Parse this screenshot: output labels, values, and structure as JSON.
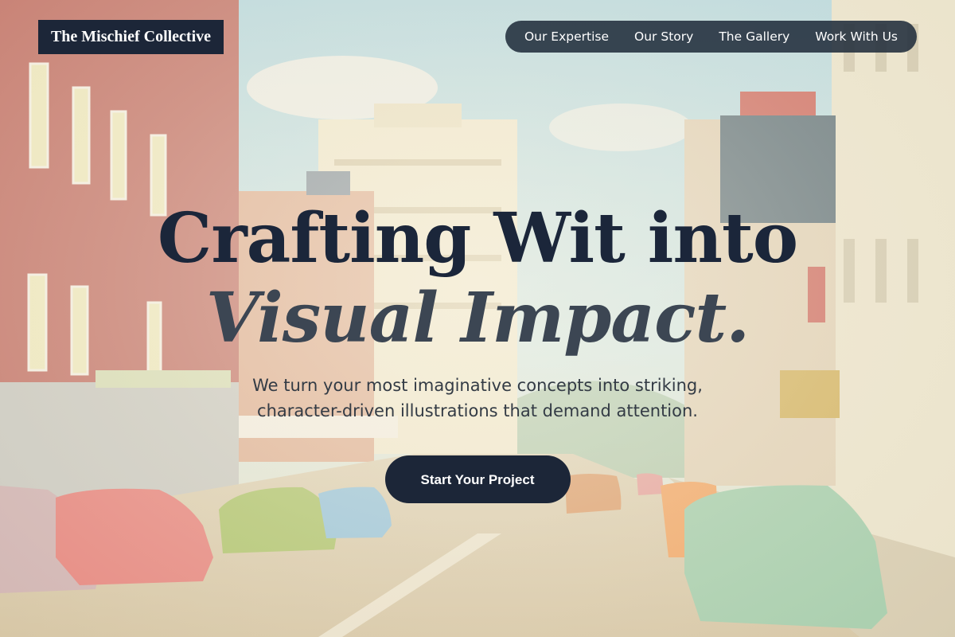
{
  "brand": {
    "logo_text": "The Mischief Collective"
  },
  "nav": {
    "items": [
      {
        "label": "Our Expertise"
      },
      {
        "label": "Our Story"
      },
      {
        "label": "The Gallery"
      },
      {
        "label": "Work With Us"
      }
    ]
  },
  "hero": {
    "headline_line1": "Crafting Wit into",
    "headline_line2": "Visual Impact.",
    "subtitle": "We turn your most imaginative concepts into striking, character-driven illustrations that demand attention.",
    "cta_label": "Start Your Project"
  },
  "colors": {
    "primary_dark": "#1c2638",
    "nav_background": "#212d3c",
    "headline": "#1b263a",
    "headline_italic": "#3c4653",
    "body_text": "#333b45"
  }
}
